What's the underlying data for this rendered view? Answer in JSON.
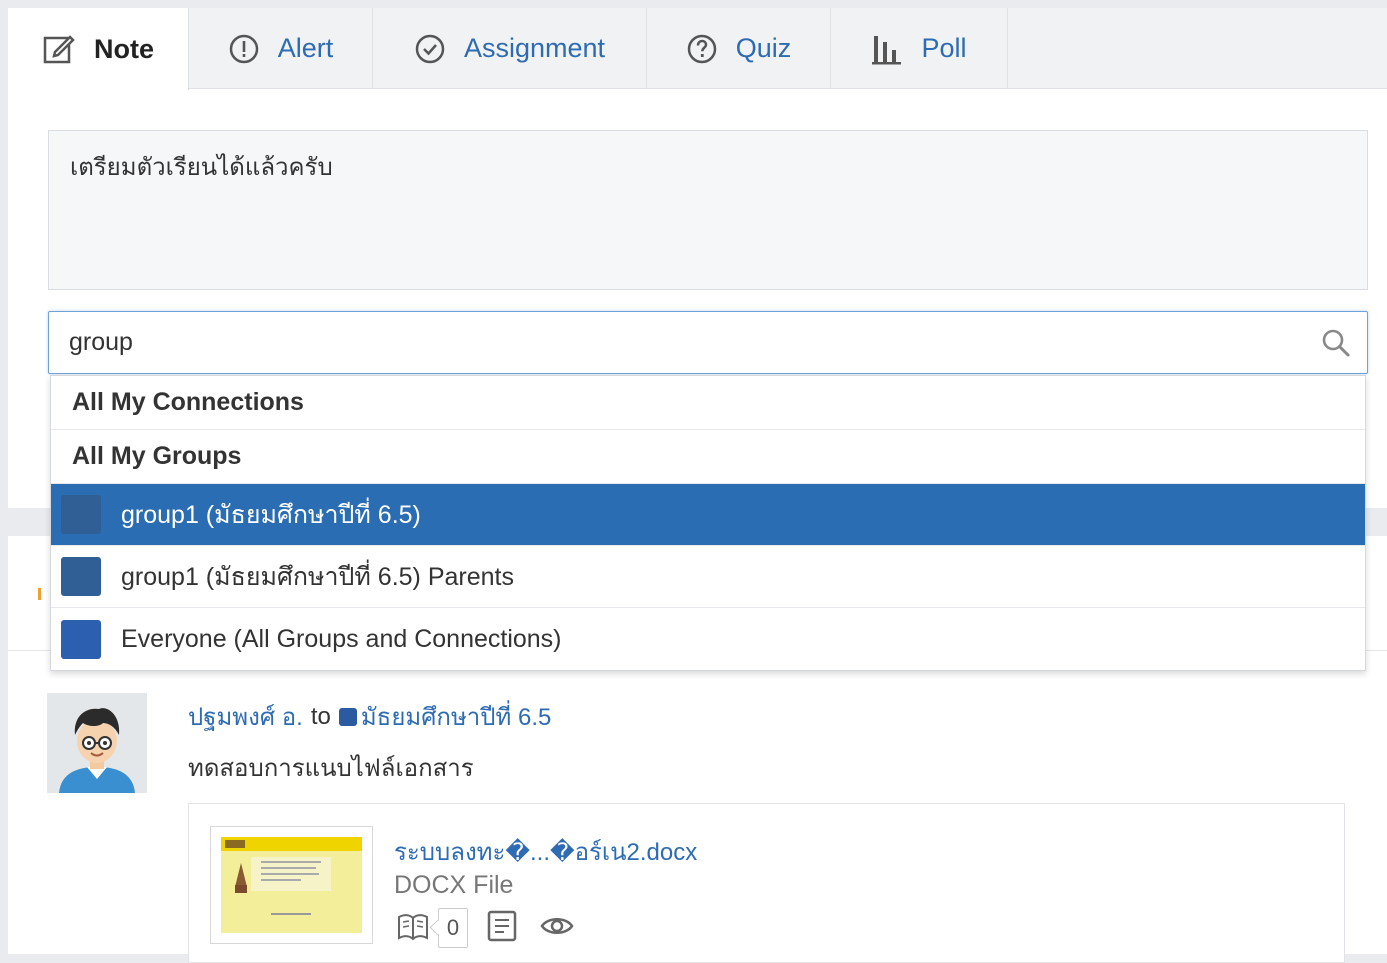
{
  "tabs": [
    {
      "label": "Note",
      "icon": "edit-note-icon",
      "active": true
    },
    {
      "label": "Alert",
      "icon": "alert-circle-icon",
      "active": false
    },
    {
      "label": "Assignment",
      "icon": "check-circle-icon",
      "active": false
    },
    {
      "label": "Quiz",
      "icon": "question-circle-icon",
      "active": false
    },
    {
      "label": "Poll",
      "icon": "bar-chart-icon",
      "active": false
    }
  ],
  "composer": {
    "note_text": "เตรียมตัวเรียนได้แล้วครับ",
    "recipient_query": "group"
  },
  "dropdown": {
    "headers": [
      "All My Connections",
      "All My Groups"
    ],
    "items": [
      {
        "label": "group1 (มัธยมศึกษาปีที่ 6.5)",
        "color": "#2f5f94",
        "selected": true
      },
      {
        "label": "group1 (มัธยมศึกษาปีที่ 6.5) Parents",
        "color": "#2f5f94",
        "selected": false
      },
      {
        "label": "Everyone (All Groups and Connections)",
        "color": "#2d5fb0",
        "selected": false
      }
    ]
  },
  "post": {
    "author": "ปฐมพงศ์ อ.",
    "to_word": "to",
    "group": "มัธยมศึกษาปีที่ 6.5",
    "text": "ทดสอบการแนบไฟล์เอกสาร",
    "attachment": {
      "file_name": "ระบบลงทะ�...�อร์เน2.docx",
      "file_type": "DOCX File",
      "count": "0"
    }
  },
  "colors": {
    "accent": "#2d6bb3",
    "selected_bg": "#2a6db2"
  }
}
